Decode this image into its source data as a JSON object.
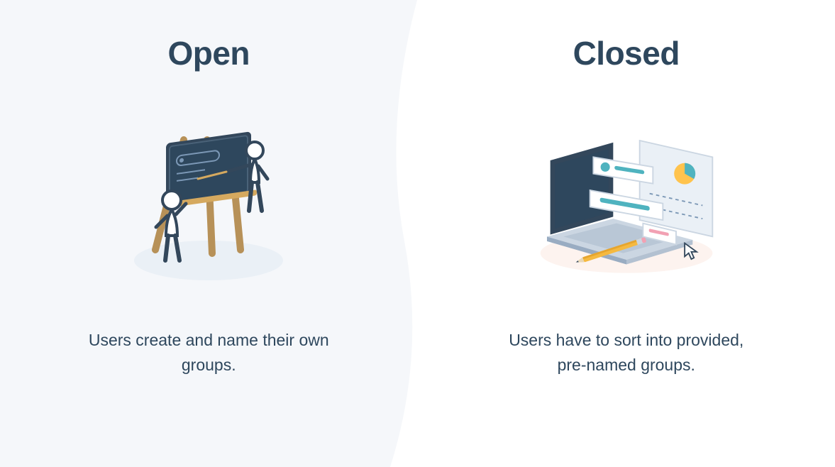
{
  "left": {
    "heading": "Open",
    "description": "Users create and name their own groups."
  },
  "right": {
    "heading": "Closed",
    "description": "Users have to sort into provided, pre-named groups."
  }
}
